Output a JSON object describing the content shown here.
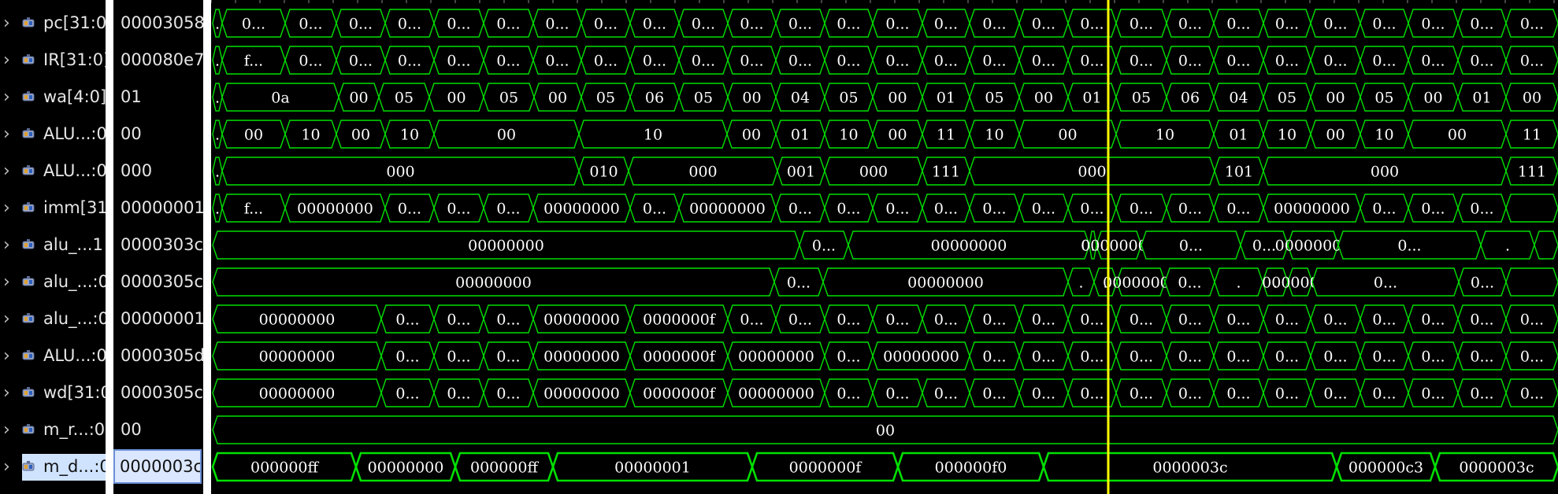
{
  "signals": [
    {
      "name": "pc[31:0",
      "value": "00003058",
      "labels": [
        ".",
        "0...",
        "0...",
        "0...",
        "0...",
        "0...",
        "0...",
        "0...",
        "0...",
        "0...",
        "0...",
        "0...",
        "0...",
        "0...",
        "0...",
        "0...",
        "0...",
        "0...",
        "0...",
        "0...",
        "0...",
        "0...",
        "0...",
        "0...",
        "0...",
        "0...",
        "0...",
        "0...",
        "0..."
      ]
    },
    {
      "name": "IR[31:0]",
      "value": "000080e7",
      "labels": [
        ".",
        "f...",
        "0...",
        "0...",
        "0...",
        "0...",
        "0...",
        "0...",
        "0...",
        "0...",
        "0...",
        "0...",
        "0...",
        "0...",
        "0...",
        "0...",
        "0...",
        "0...",
        "0...",
        "0...",
        "0...",
        "0...",
        "0...",
        "0...",
        "0...",
        "0...",
        "0...",
        "0...",
        "0..."
      ]
    },
    {
      "name": "wa[4:0]",
      "value": "01",
      "labels": [
        ".",
        "0a",
        "00",
        "05",
        "00",
        "05",
        "00",
        "05",
        "06",
        "05",
        "00",
        "04",
        "05",
        "00",
        "01",
        "05",
        "00",
        "01",
        "05",
        "06",
        "04",
        "05",
        "00",
        "05",
        "00",
        "01",
        "00"
      ]
    },
    {
      "name": "ALU...:0",
      "value": "00",
      "labels": [
        ".",
        "00",
        "10",
        "00",
        "10",
        "00",
        "10",
        "00",
        "01",
        "10",
        "00",
        "11",
        "10",
        "00",
        "10",
        "01",
        "10",
        "00",
        "10",
        "00",
        "11"
      ]
    },
    {
      "name": "ALU...:0",
      "value": "000",
      "labels": [
        ".",
        "000",
        "010",
        "000",
        "001",
        "000",
        "111",
        "000",
        "101",
        "000",
        "111"
      ]
    },
    {
      "name": "imm[31",
      "value": "00000001",
      "labels": [
        ".",
        "f...",
        "00000000",
        "0...",
        "0...",
        "0...",
        "00000000",
        "0...",
        "00000000",
        "0...",
        "0...",
        "0...",
        "0...",
        "0...",
        "0...",
        "0...",
        "0...",
        "0...",
        "0...",
        "00000000",
        "0...",
        "0...",
        "0..."
      ]
    },
    {
      "name": "alu_...1",
      "value": "0000303c",
      "labels": [
        "00000000",
        "0...",
        "00000000",
        "0...",
        "00000000",
        "0...",
        "0...",
        "00000000",
        "0...",
        "."
      ]
    },
    {
      "name": "alu_...:0",
      "value": "0000305c",
      "labels": [
        "00000000",
        "0...",
        "00000000",
        ".",
        ".",
        "00000000",
        "0...",
        ".",
        ".",
        "00000000",
        "0...",
        "0..."
      ]
    },
    {
      "name": "alu_...:0",
      "value": "00000001",
      "labels": [
        "00000000",
        "0...",
        "0...",
        "0...",
        "00000000",
        "0000000f",
        "0...",
        "0...",
        "0...",
        "0...",
        "0...",
        "0...",
        "0...",
        "0...",
        "0...",
        "0...",
        "0...",
        "0...",
        "0...",
        "0...",
        "0...",
        "0...",
        "0...",
        "0...",
        "0..."
      ]
    },
    {
      "name": "ALU...:0",
      "value": "0000305d",
      "labels": [
        "00000000",
        "0...",
        "0...",
        "0...",
        "00000000",
        "0000000f",
        "00000000",
        "0...",
        "00000000",
        "0...",
        "0...",
        "0...",
        "0...",
        "0...",
        "0...",
        "0...",
        "0...",
        "0...",
        "0...",
        "0...",
        "0...",
        "0..."
      ]
    },
    {
      "name": "wd[31:0",
      "value": "0000305c",
      "labels": [
        "00000000",
        "0...",
        "0...",
        "0...",
        "00000000",
        "0000000f",
        "00000000",
        "0...",
        "0...",
        "0...",
        "0...",
        "0...",
        "0...",
        "0...",
        "0...",
        "0...",
        "0...",
        "0...",
        "0...",
        "0...",
        "0...",
        "0...",
        "0...",
        "0..."
      ]
    },
    {
      "name": "m_r...:0",
      "value": "00",
      "labels": [
        "00"
      ]
    },
    {
      "name": "m_d...:0",
      "value": "0000003c",
      "labels": [
        "000000ff",
        "00000000",
        "000000ff",
        "00000001",
        "0000000f",
        "000000f0",
        "0000003c",
        "000000c3",
        "0000003c"
      ],
      "selected": true
    }
  ],
  "icon": "signal-bus-icon",
  "colors": {
    "wave": "#00e000",
    "cursor": "#ffff00",
    "text": "#ffffff",
    "selected_bg": "#cfe3ff"
  }
}
